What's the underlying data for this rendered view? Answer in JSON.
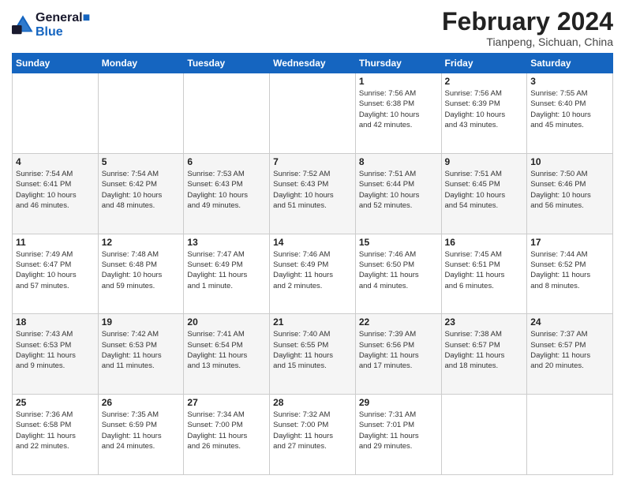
{
  "header": {
    "logo_line1": "General",
    "logo_line2": "Blue",
    "month_title": "February 2024",
    "location": "Tianpeng, Sichuan, China"
  },
  "days_of_week": [
    "Sunday",
    "Monday",
    "Tuesday",
    "Wednesday",
    "Thursday",
    "Friday",
    "Saturday"
  ],
  "weeks": [
    [
      {
        "num": "",
        "info": ""
      },
      {
        "num": "",
        "info": ""
      },
      {
        "num": "",
        "info": ""
      },
      {
        "num": "",
        "info": ""
      },
      {
        "num": "1",
        "info": "Sunrise: 7:56 AM\nSunset: 6:38 PM\nDaylight: 10 hours\nand 42 minutes."
      },
      {
        "num": "2",
        "info": "Sunrise: 7:56 AM\nSunset: 6:39 PM\nDaylight: 10 hours\nand 43 minutes."
      },
      {
        "num": "3",
        "info": "Sunrise: 7:55 AM\nSunset: 6:40 PM\nDaylight: 10 hours\nand 45 minutes."
      }
    ],
    [
      {
        "num": "4",
        "info": "Sunrise: 7:54 AM\nSunset: 6:41 PM\nDaylight: 10 hours\nand 46 minutes."
      },
      {
        "num": "5",
        "info": "Sunrise: 7:54 AM\nSunset: 6:42 PM\nDaylight: 10 hours\nand 48 minutes."
      },
      {
        "num": "6",
        "info": "Sunrise: 7:53 AM\nSunset: 6:43 PM\nDaylight: 10 hours\nand 49 minutes."
      },
      {
        "num": "7",
        "info": "Sunrise: 7:52 AM\nSunset: 6:43 PM\nDaylight: 10 hours\nand 51 minutes."
      },
      {
        "num": "8",
        "info": "Sunrise: 7:51 AM\nSunset: 6:44 PM\nDaylight: 10 hours\nand 52 minutes."
      },
      {
        "num": "9",
        "info": "Sunrise: 7:51 AM\nSunset: 6:45 PM\nDaylight: 10 hours\nand 54 minutes."
      },
      {
        "num": "10",
        "info": "Sunrise: 7:50 AM\nSunset: 6:46 PM\nDaylight: 10 hours\nand 56 minutes."
      }
    ],
    [
      {
        "num": "11",
        "info": "Sunrise: 7:49 AM\nSunset: 6:47 PM\nDaylight: 10 hours\nand 57 minutes."
      },
      {
        "num": "12",
        "info": "Sunrise: 7:48 AM\nSunset: 6:48 PM\nDaylight: 10 hours\nand 59 minutes."
      },
      {
        "num": "13",
        "info": "Sunrise: 7:47 AM\nSunset: 6:49 PM\nDaylight: 11 hours\nand 1 minute."
      },
      {
        "num": "14",
        "info": "Sunrise: 7:46 AM\nSunset: 6:49 PM\nDaylight: 11 hours\nand 2 minutes."
      },
      {
        "num": "15",
        "info": "Sunrise: 7:46 AM\nSunset: 6:50 PM\nDaylight: 11 hours\nand 4 minutes."
      },
      {
        "num": "16",
        "info": "Sunrise: 7:45 AM\nSunset: 6:51 PM\nDaylight: 11 hours\nand 6 minutes."
      },
      {
        "num": "17",
        "info": "Sunrise: 7:44 AM\nSunset: 6:52 PM\nDaylight: 11 hours\nand 8 minutes."
      }
    ],
    [
      {
        "num": "18",
        "info": "Sunrise: 7:43 AM\nSunset: 6:53 PM\nDaylight: 11 hours\nand 9 minutes."
      },
      {
        "num": "19",
        "info": "Sunrise: 7:42 AM\nSunset: 6:53 PM\nDaylight: 11 hours\nand 11 minutes."
      },
      {
        "num": "20",
        "info": "Sunrise: 7:41 AM\nSunset: 6:54 PM\nDaylight: 11 hours\nand 13 minutes."
      },
      {
        "num": "21",
        "info": "Sunrise: 7:40 AM\nSunset: 6:55 PM\nDaylight: 11 hours\nand 15 minutes."
      },
      {
        "num": "22",
        "info": "Sunrise: 7:39 AM\nSunset: 6:56 PM\nDaylight: 11 hours\nand 17 minutes."
      },
      {
        "num": "23",
        "info": "Sunrise: 7:38 AM\nSunset: 6:57 PM\nDaylight: 11 hours\nand 18 minutes."
      },
      {
        "num": "24",
        "info": "Sunrise: 7:37 AM\nSunset: 6:57 PM\nDaylight: 11 hours\nand 20 minutes."
      }
    ],
    [
      {
        "num": "25",
        "info": "Sunrise: 7:36 AM\nSunset: 6:58 PM\nDaylight: 11 hours\nand 22 minutes."
      },
      {
        "num": "26",
        "info": "Sunrise: 7:35 AM\nSunset: 6:59 PM\nDaylight: 11 hours\nand 24 minutes."
      },
      {
        "num": "27",
        "info": "Sunrise: 7:34 AM\nSunset: 7:00 PM\nDaylight: 11 hours\nand 26 minutes."
      },
      {
        "num": "28",
        "info": "Sunrise: 7:32 AM\nSunset: 7:00 PM\nDaylight: 11 hours\nand 27 minutes."
      },
      {
        "num": "29",
        "info": "Sunrise: 7:31 AM\nSunset: 7:01 PM\nDaylight: 11 hours\nand 29 minutes."
      },
      {
        "num": "",
        "info": ""
      },
      {
        "num": "",
        "info": ""
      }
    ]
  ]
}
